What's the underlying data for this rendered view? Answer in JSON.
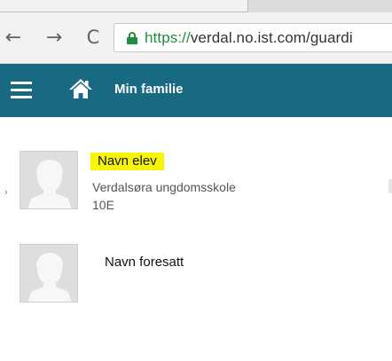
{
  "browser": {
    "url_scheme": "https://",
    "url_rest": "verdal.no.ist.com/guardi",
    "back_icon": "←",
    "forward_icon": "→",
    "reload_icon": "C"
  },
  "appbar": {
    "title": "Min familie",
    "background_color": "#176a82"
  },
  "persons": [
    {
      "name": "Navn elev",
      "school": "Verdalsøra ungdomsskole",
      "grade": "10E",
      "highlight_color": "#f6f600"
    },
    {
      "name": "Navn foresatt"
    }
  ]
}
